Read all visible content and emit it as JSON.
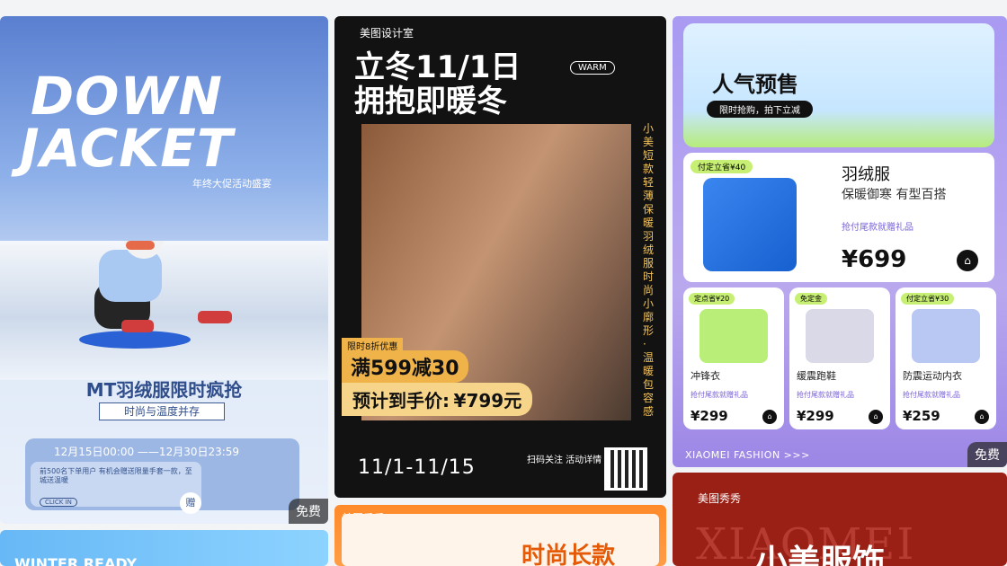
{
  "badges": {
    "free": "免费"
  },
  "card1": {
    "title_line1": "DOWN",
    "title_line2": "JACKET",
    "subtitle": "年终大促活动盛宴",
    "main_title": "MT羽绒服限时疯抢",
    "tag": "时尚与温度并存",
    "date_range": "12月15日00:00 ——12月30日23:59",
    "coupon_text": "前500名下单用户\n有机会赠送限量手套一款，至城送温暖",
    "coupon_button": "CLICK IN",
    "gift_text": "赠"
  },
  "card2": {
    "brand": "美图设计室",
    "headline_line1": "立冬11/1日",
    "headline_line2": "拥抱即暖冬",
    "warm_tag": "WARM",
    "vertical_text": "小美短款轻薄保暖羽绒服 时尚小廓形·温暖包容感",
    "promo_label": "限时8折优惠",
    "promo_discount": "满599减30",
    "promo_price_label": "预计到手价:",
    "promo_price": "¥799元",
    "dates": "11/1-11/15",
    "scan_text": "扫码关注\n活动详情"
  },
  "card3": {
    "hero_title": "人气预售",
    "hero_pill": "限时抢购，拍下立减",
    "main_label": "付定立省¥40",
    "main_name": "羽绒服",
    "main_desc": "保暖御寒 有型百搭",
    "main_gift": "抢付尾款就赠礼品",
    "main_price": "¥699",
    "items": [
      {
        "label": "定点省¥20",
        "name": "冲锋衣",
        "gift": "抢付尾款就赠礼品",
        "price": "¥299"
      },
      {
        "label": "免定金",
        "name": "缓震跑鞋",
        "gift": "抢付尾款就赠礼品",
        "price": "¥299"
      },
      {
        "label": "付定立省¥30",
        "name": "防震运动内衣",
        "gift": "抢付尾款就赠礼品",
        "price": "¥259"
      }
    ],
    "footer": "XIAOMEI FASHION >>>"
  },
  "card4": {
    "title": "WINTER READY"
  },
  "card5": {
    "brand": "美图秀秀",
    "text": "时尚长款"
  },
  "card6": {
    "brand": "美图秀秀",
    "bg_text": "XIAOMEI",
    "title": "小美服饰"
  }
}
